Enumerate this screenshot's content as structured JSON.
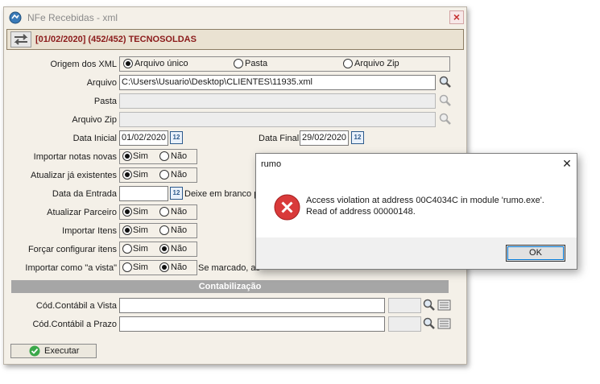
{
  "window": {
    "title": "NFe Recebidas - xml"
  },
  "header": {
    "text": "[01/02/2020] (452/452) TECNOSOLDAS"
  },
  "form": {
    "origem": {
      "label": "Origem dos XML",
      "options": [
        "Arquivo único",
        "Pasta",
        "Arquivo Zip"
      ],
      "selected": "Arquivo único"
    },
    "arquivo": {
      "label": "Arquivo",
      "value": "C:\\Users\\Usuario\\Desktop\\CLIENTES\\11935.xml"
    },
    "pasta": {
      "label": "Pasta",
      "value": ""
    },
    "arquivo_zip": {
      "label": "Arquivo Zip",
      "value": ""
    },
    "data_inicial": {
      "label": "Data Inicial",
      "value": "01/02/2020"
    },
    "data_final": {
      "label": "Data Final",
      "value": "29/02/2020"
    },
    "importar_novas": {
      "label": "Importar notas novas",
      "yes": "Sim",
      "no": "Não",
      "selected": "Sim"
    },
    "atualizar_existentes": {
      "label": "Atualizar já existentes",
      "yes": "Sim",
      "no": "Não",
      "selected": "Sim"
    },
    "data_entrada": {
      "label": "Data da Entrada",
      "value": "",
      "hint": "Deixe em branco pa"
    },
    "atualizar_parceiro": {
      "label": "Atualizar Parceiro",
      "yes": "Sim",
      "no": "Não",
      "selected": "Sim"
    },
    "importar_itens": {
      "label": "Importar Itens",
      "yes": "Sim",
      "no": "Não",
      "selected": "Sim"
    },
    "forcar_configurar": {
      "label": "Forçar configurar itens",
      "yes": "Sim",
      "no": "Não",
      "selected": "Não"
    },
    "importar_vista": {
      "label": "Importar como \"a vista\"",
      "yes": "Sim",
      "no": "Não",
      "selected": "Não",
      "hint": "Se marcado, as"
    }
  },
  "contabilizacao": {
    "title": "Contabilização",
    "vista_label": "Cód.Contábil a Vista",
    "prazo_label": "Cód.Contábil a Prazo"
  },
  "execute_label": "Executar",
  "dialog": {
    "title": "rumo",
    "message_line1": "Access violation at address 00C4034C in module 'rumo.exe'.",
    "message_line2": "Read of address 00000148.",
    "ok_label": "OK"
  },
  "icons": {
    "app": "app-globe-icon",
    "swap": "swap-arrows-icon",
    "lens": "magnifier-icon",
    "calendar": "calendar-icon",
    "error": "error-icon",
    "check": "check-icon"
  },
  "colors": {
    "header_text": "#8b1a1a",
    "error_red": "#d93a3a",
    "section_gray": "#a6a6a6"
  }
}
